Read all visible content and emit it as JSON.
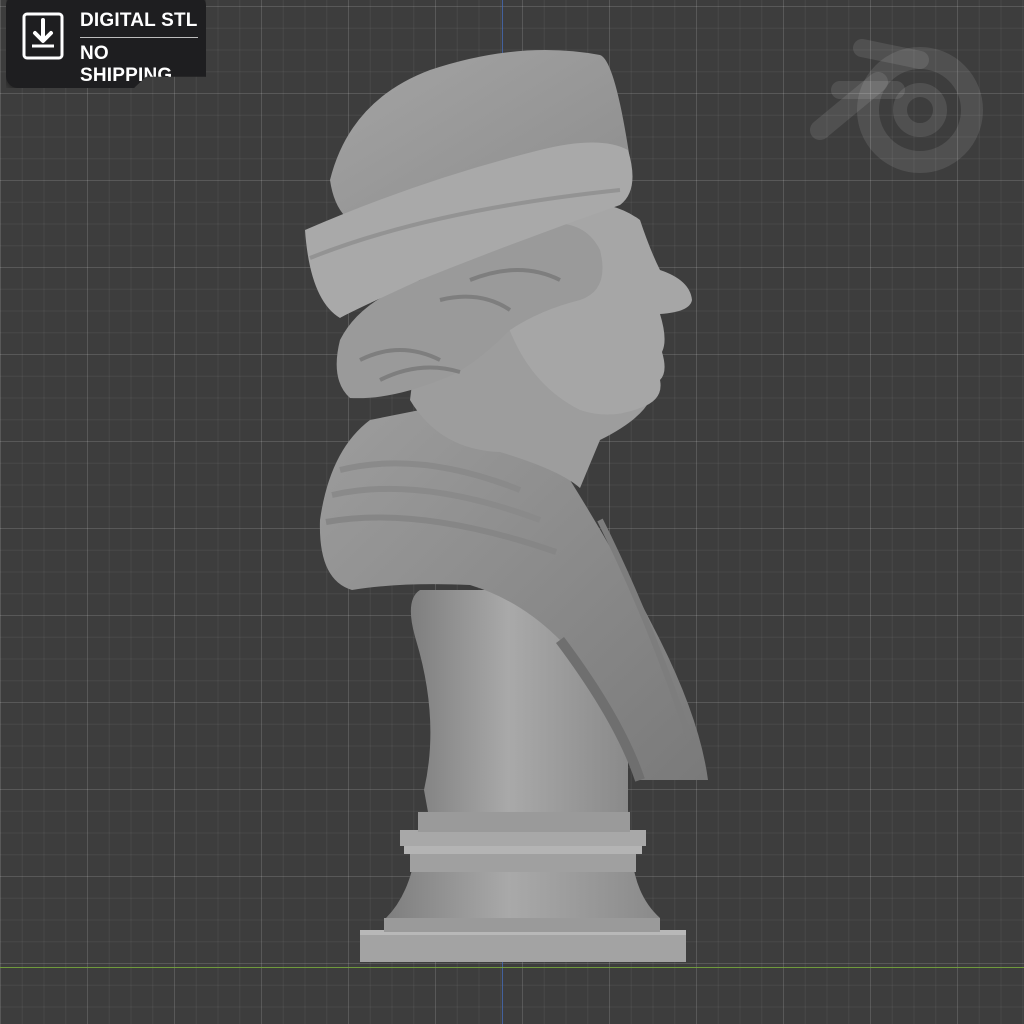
{
  "badge": {
    "line1": "DIGITAL STL",
    "line2": "NO SHIPPING",
    "icon": "download-icon"
  },
  "viewport": {
    "background_color": "#3d3d3d",
    "grid_color": "#4a4a4a",
    "x_axis_color": "#6b9a3a",
    "y_axis_color": "#4a6eb8",
    "model": "bust-sculpture",
    "watermark_icon": "blender-logo-icon"
  }
}
